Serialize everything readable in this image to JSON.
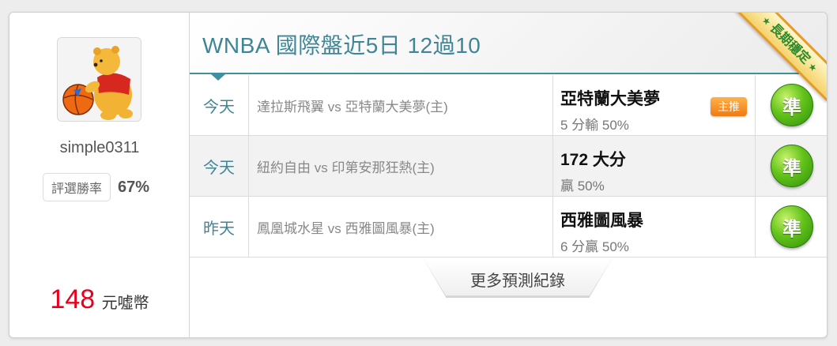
{
  "user": {
    "username": "simple0311",
    "rate_label": "評選勝率",
    "rate_value": "67%",
    "coins_amount": "148",
    "coins_unit": "元噓幣"
  },
  "header": {
    "title": "WNBA 國際盤近5日 12過10",
    "ribbon_text": "長期穩定"
  },
  "predictions": [
    {
      "day": "今天",
      "match": "達拉斯飛翼 vs 亞特蘭大美夢(主)",
      "pick": "亞特蘭大美夢",
      "detail": "5 分輸 50%",
      "badge": "主推",
      "result": "準"
    },
    {
      "day": "今天",
      "match": "紐約自由 vs 印第安那狂熱(主)",
      "pick": "172 大分",
      "detail": "贏 50%",
      "badge": "",
      "result": "準"
    },
    {
      "day": "昨天",
      "match": "鳳凰城水星 vs 西雅圖風暴(主)",
      "pick": "西雅圖風暴",
      "detail": "6 分贏 50%",
      "badge": "",
      "result": "準"
    }
  ],
  "more_label": "更多預測紀錄",
  "colors": {
    "accent": "#3f8596",
    "coins": "#e8001c",
    "result_green": "#63c31a",
    "badge_orange": "#f07a12"
  }
}
